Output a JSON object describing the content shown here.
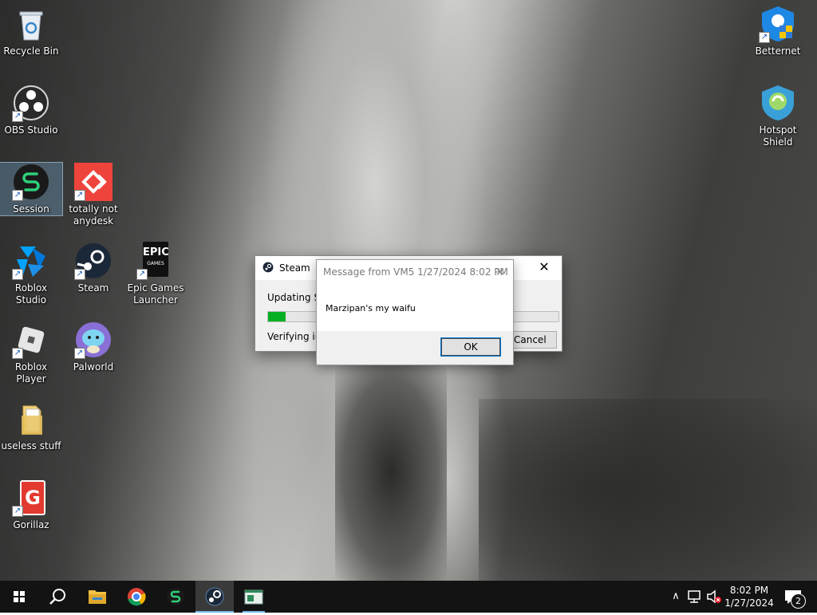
{
  "desktop_icons": {
    "recycle_bin": "Recycle Bin",
    "obs": "OBS Studio",
    "session": "Session",
    "anydesk_line1": "totally not",
    "anydesk_line2": "anydesk",
    "roblox_studio": "Roblox Studio",
    "steam": "Steam",
    "epic_line1": "Epic Games",
    "epic_line2": "Launcher",
    "roblox_player": "Roblox Player",
    "palworld": "Palworld",
    "useless": "useless stuff",
    "gorillaz": "Gorillaz",
    "betternet": "Betternet",
    "hotspot_line1": "Hotspot",
    "hotspot_line2": "Shield",
    "epic_logo_top": "EPIC",
    "epic_logo_bottom": "GAMES",
    "gorillaz_glyph": "G"
  },
  "steam_dialog": {
    "title": "Steam",
    "status": "Updating St",
    "progress": 0.06,
    "detail": "Verifying ins",
    "cancel_label": "Cancel",
    "close_glyph": "✕"
  },
  "message_dialog": {
    "title": "Message from VM5 1/27/2024 8:02 PM",
    "text": "Marzipan's my waifu",
    "ok_label": "OK",
    "close_glyph": "✕"
  },
  "taskbar": {
    "time": "8:02 PM",
    "date": "1/27/2024",
    "notification_count": "2",
    "chevron": "∧"
  },
  "colors": {
    "taskbar": "#131313",
    "progress": "#06b025",
    "accent": "#0078d7"
  }
}
